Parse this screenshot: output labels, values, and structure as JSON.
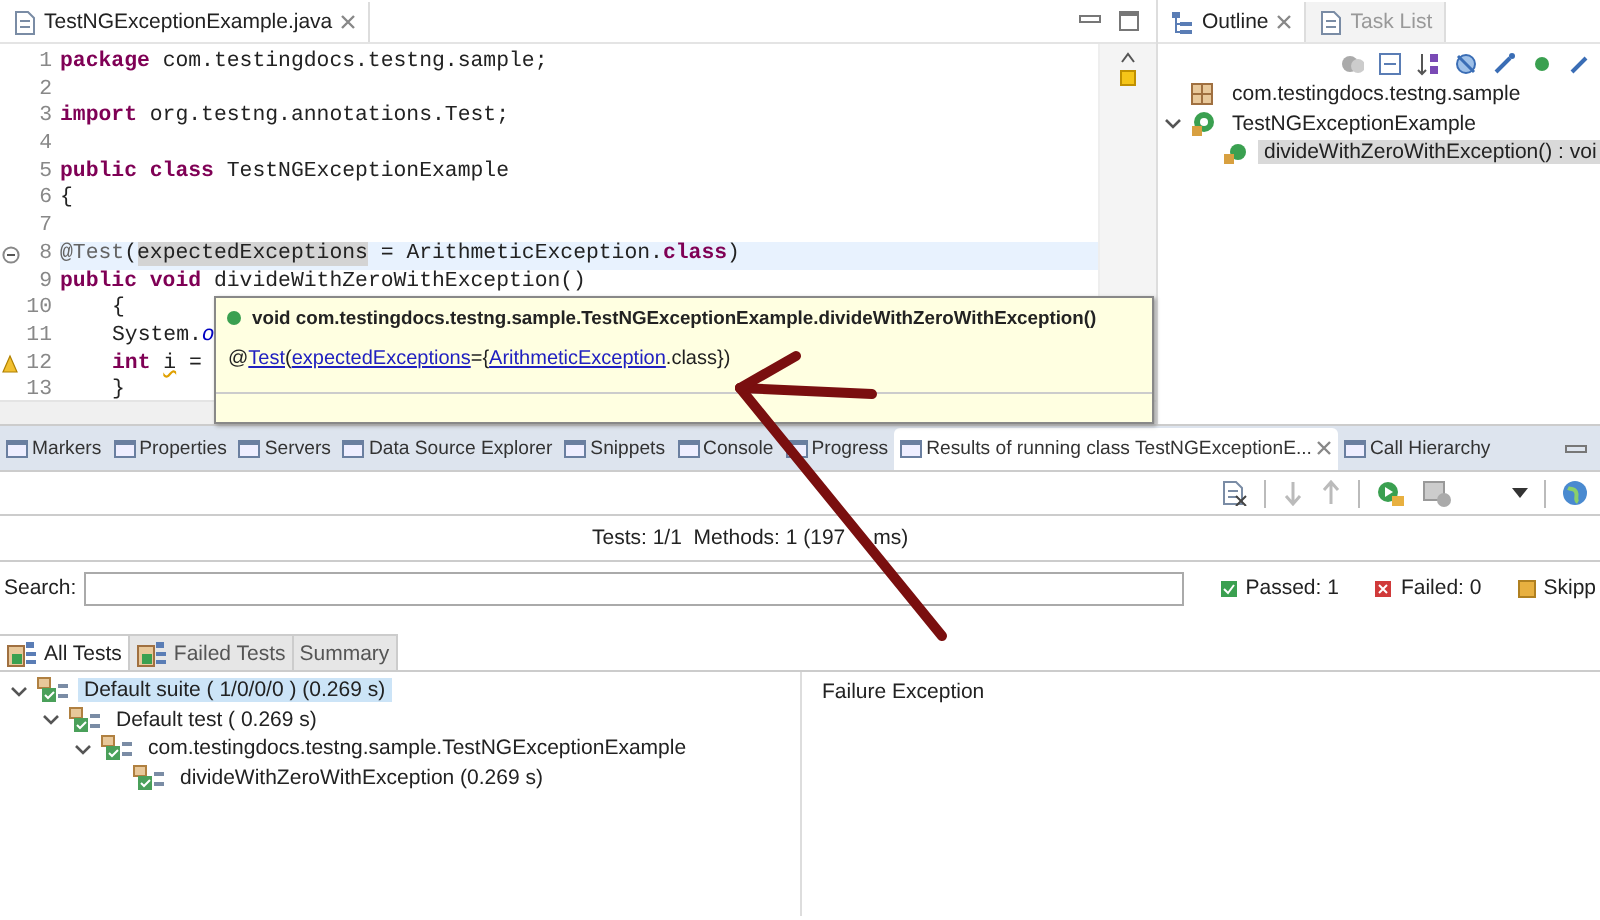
{
  "editor": {
    "tab": {
      "label": "TestNGExceptionExample.java",
      "selected": true
    },
    "lines": [
      {
        "number": "1",
        "current": false,
        "tokens": [
          {
            "kind": "keyword",
            "text": "package"
          },
          {
            "kind": "plain",
            "text": " com.testingdocs.testng.sample;"
          }
        ]
      },
      {
        "number": "2",
        "current": false
      },
      {
        "number": "3",
        "current": false,
        "tokens": [
          {
            "kind": "keyword",
            "text": "import"
          },
          {
            "kind": "plain",
            "text": " org.testng.annotations.Test;"
          }
        ]
      },
      {
        "number": "4",
        "current": false
      },
      {
        "number": "5",
        "current": false,
        "tokens": [
          {
            "kind": "keyword",
            "text": "public class"
          },
          {
            "kind": "plain",
            "text": " TestNGExceptionExample"
          }
        ]
      },
      {
        "number": "6",
        "current": false,
        "tokens": [
          {
            "kind": "plain",
            "text": "{"
          }
        ]
      },
      {
        "number": "7",
        "current": false
      },
      {
        "number": "8",
        "current": true,
        "kind": "fold",
        "tokens": [
          {
            "kind": "annotation",
            "text": "@Test"
          },
          {
            "kind": "plain",
            "text": "("
          },
          {
            "kind": "occurrence",
            "text": "expectedExceptions"
          },
          {
            "kind": "plain",
            "text": " = ArithmeticException."
          },
          {
            "kind": "keyword",
            "text": "class"
          },
          {
            "kind": "plain",
            "text": ")"
          }
        ]
      },
      {
        "number": "9",
        "current": false,
        "tokens": [
          {
            "kind": "keyword",
            "text": "public void"
          },
          {
            "kind": "plain",
            "text": " divideWithZeroWithException()"
          }
        ]
      },
      {
        "number": "10",
        "current": false,
        "indented": true,
        "tokens": [
          {
            "kind": "plain",
            "text": "{"
          }
        ]
      },
      {
        "number": "11",
        "current": false,
        "indented": true,
        "tokens": [
          {
            "kind": "plain",
            "text": "System."
          },
          {
            "kind": "field",
            "text": "o"
          }
        ]
      },
      {
        "number": "12",
        "current": false,
        "indented": true,
        "kind": "warning",
        "tokens": [
          {
            "kind": "keyword",
            "text": "int"
          },
          {
            "kind": "warning",
            "text": "i"
          },
          {
            "kind": "plain",
            "text": " ="
          }
        ]
      },
      {
        "number": "13",
        "current": false,
        "indented": true,
        "tokens": [
          {
            "kind": "plain",
            "text": "}"
          }
        ]
      }
    ]
  },
  "tooltip": {
    "signature": "void com.testingdocs.testng.sample.TestNGExceptionExample.divideWithZeroWithException()",
    "parts": [
      {
        "kind": "text",
        "text": "@"
      },
      {
        "kind": "link",
        "text": "Test"
      },
      {
        "kind": "text",
        "text": "("
      },
      {
        "kind": "link",
        "text": "expectedExceptions"
      },
      {
        "kind": "text",
        "text": "={"
      },
      {
        "kind": "link",
        "text": "ArithmeticException"
      },
      {
        "kind": "text",
        "text": ".class})"
      }
    ]
  },
  "outline": {
    "tabs": [
      {
        "label": "Outline",
        "selected": true
      },
      {
        "label": "Task List",
        "selected": false
      }
    ],
    "tree": [
      {
        "label": "com.testingdocs.testng.sample",
        "kind": "package",
        "selected": false
      },
      {
        "label": "TestNGExceptionExample",
        "kind": "class",
        "selected": false,
        "expanded": true,
        "children": [
          {
            "label": "divideWithZeroWithException() : voi",
            "kind": "method",
            "selected": true
          }
        ]
      }
    ]
  },
  "views": {
    "tabs": [
      {
        "label": "Markers",
        "selected": false
      },
      {
        "label": "Properties",
        "selected": false
      },
      {
        "label": "Servers",
        "selected": false
      },
      {
        "label": "Data Source Explorer",
        "selected": false
      },
      {
        "label": "Snippets",
        "selected": false
      },
      {
        "label": "Console",
        "selected": false
      },
      {
        "label": "Progress",
        "selected": false
      },
      {
        "label": "Results of running class TestNGExceptionE...",
        "selected": true
      },
      {
        "label": "Call Hierarchy",
        "selected": false
      }
    ]
  },
  "results": {
    "summary": [
      "Tests: 1/1  Methods: 1 (197",
      "ms)"
    ],
    "search_label": "Search:",
    "counters": [
      {
        "kind": "passed",
        "text": "Passed: 1"
      },
      {
        "kind": "failed",
        "text": "Failed: 0"
      },
      {
        "kind": "skipped",
        "text": "Skipp"
      }
    ],
    "tabs": [
      {
        "label": "All Tests",
        "selected": true
      },
      {
        "label": "Failed Tests",
        "selected": false
      },
      {
        "label": "Summary",
        "selected": false
      }
    ],
    "tree": [
      {
        "label": "Default suite ( 1/0/0/0 ) (0.269 s)",
        "selected": true,
        "expanded": true,
        "children": [
          {
            "label": "Default test ( 0.269 s)",
            "selected": false,
            "expanded": true,
            "children": [
              {
                "label": "com.testingdocs.testng.sample.TestNGExceptionExample",
                "selected": false,
                "expanded": true,
                "children": [
                  {
                    "label": "divideWithZeroWithException  (0.269 s)",
                    "selected": false
                  }
                ]
              }
            ]
          }
        ]
      }
    ],
    "detail_title": "Failure Exception"
  }
}
